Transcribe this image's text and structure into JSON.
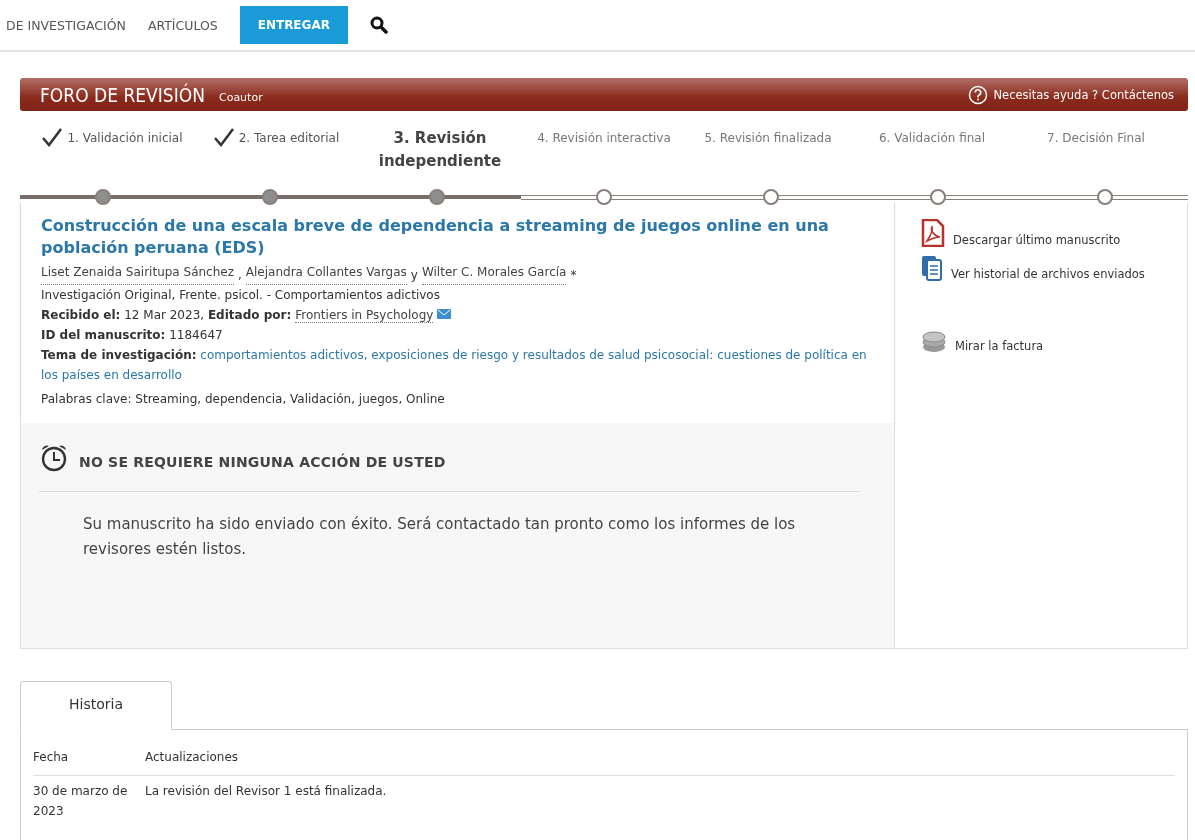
{
  "nav": {
    "items": [
      {
        "label": "DE INVESTIGACIÓN",
        "kind": "link"
      },
      {
        "label": "ARTÍCULOS",
        "kind": "link"
      },
      {
        "label": "ENTREGAR",
        "kind": "button"
      }
    ]
  },
  "header": {
    "title": "FORO DE REVISIÓN",
    "role": "Coautor",
    "help": "Necesitas ayuda ? Contáctenos"
  },
  "steps": [
    {
      "label": "1. Validación inicial",
      "done": true,
      "current": false
    },
    {
      "label": "2. Tarea editorial",
      "done": true,
      "current": false
    },
    {
      "label": "3. Revisión independiente",
      "done": false,
      "current": true
    },
    {
      "label": "4. Revisión interactiva",
      "done": false,
      "current": false
    },
    {
      "label": "5. Revisión finalizada",
      "done": false,
      "current": false
    },
    {
      "label": "6. Validación final",
      "done": false,
      "current": false
    },
    {
      "label": "7. Decisión Final",
      "done": false,
      "current": false
    }
  ],
  "manuscript": {
    "title": "Construcción de una escala breve de dependencia a streaming de juegos online en una población peruana (EDS)",
    "authors": [
      {
        "name": "Liset Zenaida Sairitupa Sánchez",
        "after": ","
      },
      {
        "name": "Alejandra Collantes Vargas",
        "after": "y"
      },
      {
        "name": "Wilter C. Morales García",
        "after": "*"
      }
    ],
    "type": "Investigación Original, Frente. psicol. - Comportamientos adictivos",
    "received": "**Recibido el:** 12 Mar 2023, **Editado por:**",
    "editor": "Frontiers in Psychology",
    "manuscript_id": "**ID del manuscrito:** 1184647",
    "research_topic": "**Tema de investigación:** comportamientos adictivos, exposiciones de riesgo y resultados de salud psicosocial: cuestiones de política en los países en desarrollo",
    "keywords": "Palabras clave: Streaming, dependencia, Validación, juegos, Online"
  },
  "notice": {
    "title": "NO SE REQUIERE NINGUNA ACCIÓN DE USTED",
    "message": "Su manuscrito ha sido enviado con éxito. Será contactado tan pronto como los informes de los revisores estén listos."
  },
  "actions": [
    {
      "label": "Descargar último manuscrito",
      "kind": "pdf"
    },
    {
      "label": "Ver historial de archivos enviados",
      "kind": "files"
    },
    {
      "label": "Mirar la factura",
      "kind": "invoice"
    }
  ],
  "history": {
    "tabs": [
      {
        "label": "Historia",
        "selected": true
      }
    ],
    "columns": [
      "Fecha",
      "Actualizaciones"
    ],
    "rows": [
      {
        "date": "30 de marzo de 2023",
        "update": "La revisión del Revisor 1 está finalizada."
      }
    ]
  }
}
